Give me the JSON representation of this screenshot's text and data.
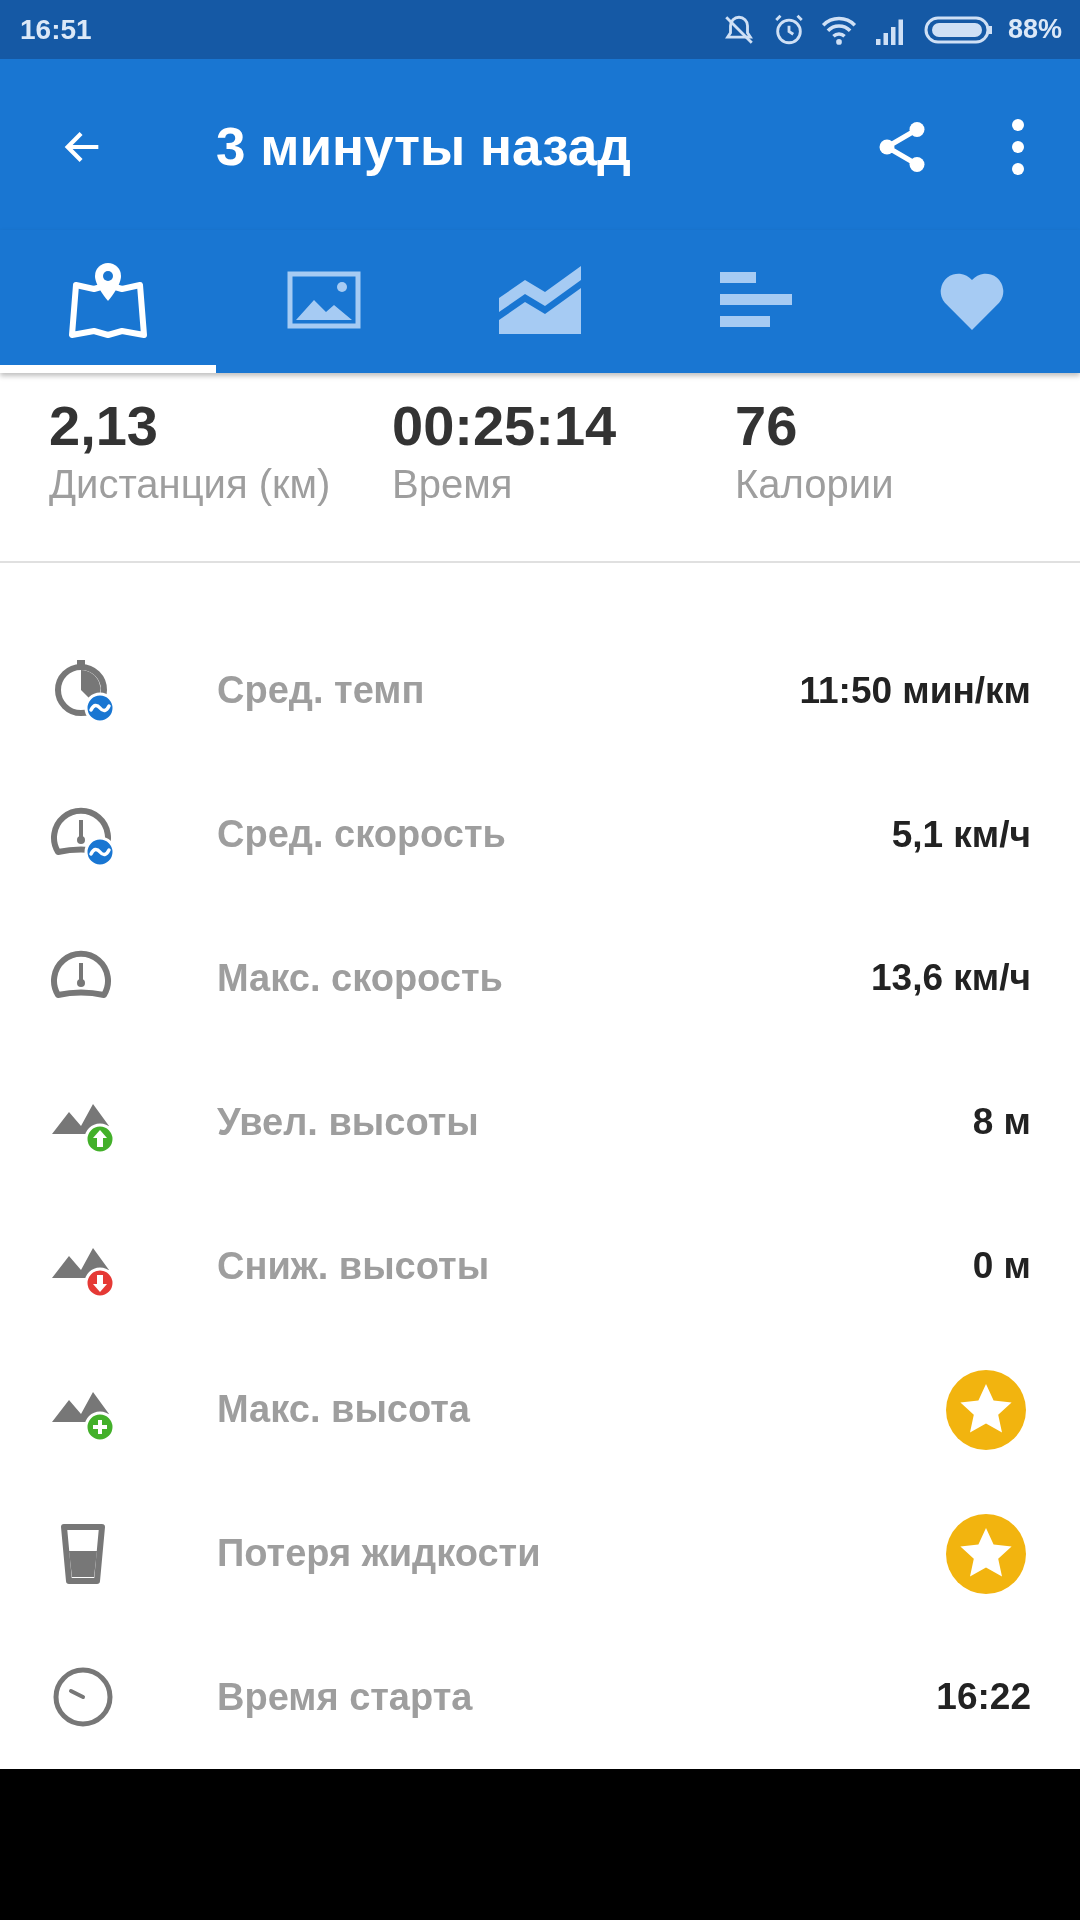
{
  "status_bar": {
    "time": "16:51",
    "battery": "88%"
  },
  "app_bar": {
    "title": "3 минуты назад"
  },
  "tabs": [
    {
      "selected": true
    },
    {
      "selected": false
    },
    {
      "selected": false
    },
    {
      "selected": false
    },
    {
      "selected": false
    }
  ],
  "summary": [
    {
      "value": "2,13",
      "label": "Дистанция (км)"
    },
    {
      "value": "00:25:14",
      "label": "Время"
    },
    {
      "value": "76",
      "label": "Калории"
    }
  ],
  "rows": [
    {
      "label": "Сред. темп",
      "kind": "text",
      "value": "11:50 мин/км"
    },
    {
      "label": "Сред. скорость",
      "kind": "text",
      "value": "5,1 км/ч"
    },
    {
      "label": "Макс. скорость",
      "kind": "text",
      "value": "13,6 км/ч"
    },
    {
      "label": "Увел. высоты",
      "kind": "text",
      "value": "8 м"
    },
    {
      "label": "Сниж. высоты",
      "kind": "text",
      "value": "0 м"
    },
    {
      "label": "Макс. высота",
      "kind": "star"
    },
    {
      "label": "Потеря жидкости",
      "kind": "star"
    },
    {
      "label": "Время старта",
      "kind": "text",
      "value": "16:22"
    }
  ]
}
